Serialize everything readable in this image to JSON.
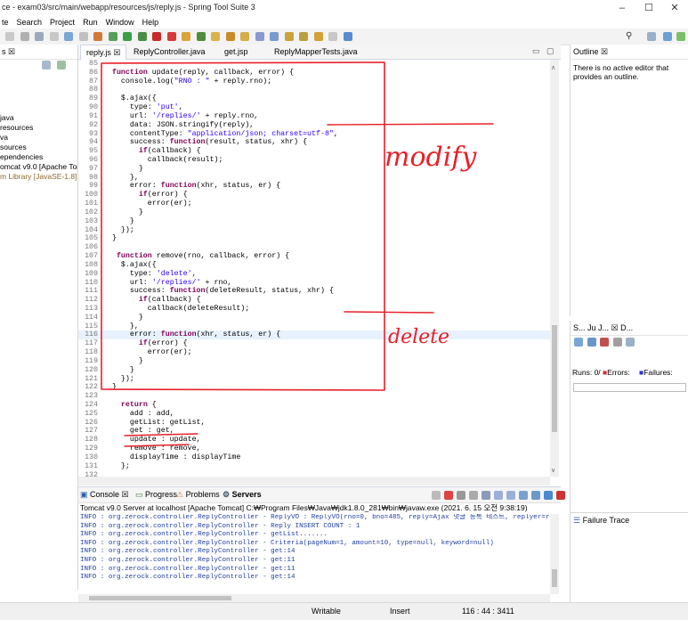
{
  "window": {
    "title": "ce - exam03/src/main/webapp/resources/js/reply.js - Spring Tool Suite 3",
    "minimize": "–",
    "maximize": "☐",
    "close": "✕"
  },
  "menu": [
    "te",
    "Search",
    "Project",
    "Run",
    "Window",
    "Help"
  ],
  "package_explorer": {
    "header": "s ☒",
    "items": [
      "",
      "",
      "",
      "",
      "java",
      "resources",
      "va",
      "sources",
      "ependencies",
      "omcat v9.0 [Apache Ton",
      "m Library [JavaSE-1.8]"
    ]
  },
  "editor": {
    "tabs": [
      {
        "label": "reply.js ☒",
        "active": true
      },
      {
        "label": "ReplyController.java",
        "active": false
      },
      {
        "label": "get.jsp",
        "active": false
      },
      {
        "label": "ReplyMapperTests.java",
        "active": false
      }
    ],
    "lines": [
      {
        "n": "85",
        "t": ""
      },
      {
        "n": "86",
        "t": "  function update(reply, callback, error) {"
      },
      {
        "n": "87",
        "t": "    console.log(\"RNO : \" + reply.rno);"
      },
      {
        "n": "88",
        "t": ""
      },
      {
        "n": "89",
        "t": "    $.ajax({"
      },
      {
        "n": "90",
        "t": "      type: 'put',"
      },
      {
        "n": "91",
        "t": "      url: '/replies/' + reply.rno,"
      },
      {
        "n": "92",
        "t": "      data: JSON.stringify(reply),"
      },
      {
        "n": "93",
        "t": "      contentType: \"application/json; charset=utf-8\","
      },
      {
        "n": "94",
        "t": "      success: function(result, status, xhr) {"
      },
      {
        "n": "95",
        "t": "        if(callback) {"
      },
      {
        "n": "96",
        "t": "          callback(result);"
      },
      {
        "n": "97",
        "t": "        }"
      },
      {
        "n": "98",
        "t": "      },"
      },
      {
        "n": "99",
        "t": "      error: function(xhr, status, er) {"
      },
      {
        "n": "100",
        "t": "        if(error) {"
      },
      {
        "n": "101",
        "t": "          error(er);"
      },
      {
        "n": "102",
        "t": "        }"
      },
      {
        "n": "103",
        "t": "      }"
      },
      {
        "n": "104",
        "t": "    });"
      },
      {
        "n": "105",
        "t": "  }"
      },
      {
        "n": "106",
        "t": ""
      },
      {
        "n": "107",
        "t": "   function remove(rno, callback, error) {"
      },
      {
        "n": "108",
        "t": "    $.ajax({"
      },
      {
        "n": "109",
        "t": "      type: 'delete',"
      },
      {
        "n": "110",
        "t": "      url: '/replies/' + rno,"
      },
      {
        "n": "111",
        "t": "      success: function(deleteResult, status, xhr) {"
      },
      {
        "n": "112",
        "t": "        if(callback) {"
      },
      {
        "n": "113",
        "t": "          callback(deleteResult);"
      },
      {
        "n": "114",
        "t": "        }"
      },
      {
        "n": "115",
        "t": "      },"
      },
      {
        "n": "116",
        "t": "      error: function(xhr, status, er) {",
        "hl": true
      },
      {
        "n": "117",
        "t": "        if(error) {"
      },
      {
        "n": "118",
        "t": "          error(er);"
      },
      {
        "n": "119",
        "t": "        }"
      },
      {
        "n": "120",
        "t": "      }"
      },
      {
        "n": "121",
        "t": "    });"
      },
      {
        "n": "122",
        "t": "  }"
      },
      {
        "n": "123",
        "t": ""
      },
      {
        "n": "124",
        "t": "    return {"
      },
      {
        "n": "125",
        "t": "      add : add,"
      },
      {
        "n": "126",
        "t": "      getList: getList,"
      },
      {
        "n": "127",
        "t": "      get : get,"
      },
      {
        "n": "128",
        "t": "      update : update,"
      },
      {
        "n": "129",
        "t": "      remove : remove,"
      },
      {
        "n": "130",
        "t": "      displayTime : displayTime"
      },
      {
        "n": "131",
        "t": "    };"
      },
      {
        "n": "132",
        "t": ""
      }
    ]
  },
  "annotations": {
    "modify": "modify",
    "delete": "delete"
  },
  "outline": {
    "header": "Outline ☒",
    "message": "There is no active editor that provides an outline."
  },
  "junit": {
    "header": "S...  Ju J...  ☒  D...",
    "runs": "Runs:  0/",
    "errors": "Errors:",
    "failures": "Failures:"
  },
  "failure_trace": {
    "header": "Failure Trace"
  },
  "console": {
    "tabs": [
      "Console ☒",
      "Progress",
      "Problems",
      "Servers"
    ],
    "info": "Tomcat v9.0 Server at localhost [Apache Tomcat] C:₩Program Files₩Java₩jdk1.8.0_281₩bin₩javaw.exe (2021. 6. 15 오전 9:38:19)",
    "lines": [
      "INFO : org.zerock.controller.ReplyController - ReplyVO : ReplyVO(rno=0, bno=485, reply=Ajax 댓글 등록 테스트, replyer=replye",
      "INFO : org.zerock.controller.ReplyController - Reply INSERT COUNT : 1",
      "INFO : org.zerock.controller.ReplyController - getList.......",
      "INFO : org.zerock.controller.ReplyController - Criteria(pageNum=1, amount=10, type=null, keyword=null)",
      "INFO : org.zerock.controller.ReplyController - get:14",
      "INFO : org.zerock.controller.ReplyController - get:11",
      "INFO : org.zerock.controller.ReplyController - get:11",
      "INFO : org.zerock.controller.ReplyController - get:14"
    ]
  },
  "status_bar": {
    "writable": "Writable",
    "insert": "Insert",
    "position": "116 : 44 : 3411"
  },
  "colors": {
    "annotation": "#e8202a",
    "keyword": "#7f0055",
    "string": "#2a00ff",
    "console_text": "#1f3f9f"
  }
}
